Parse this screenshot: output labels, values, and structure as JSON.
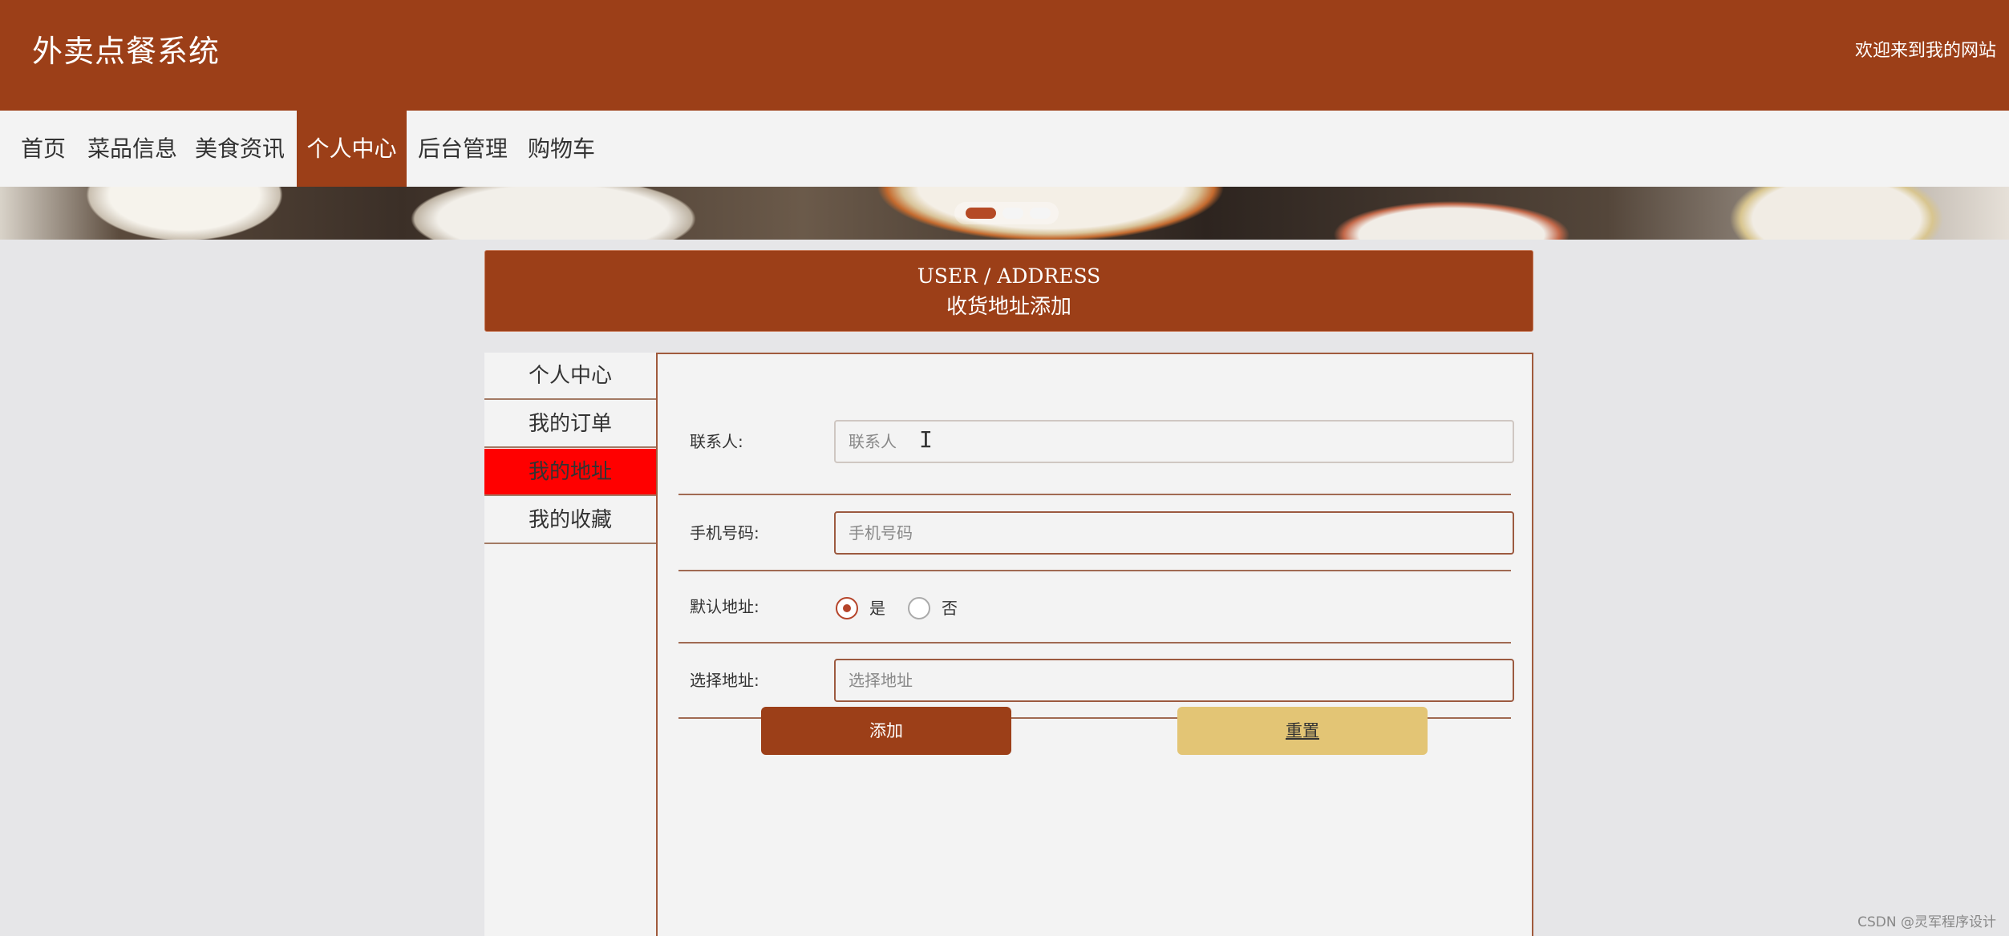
{
  "header": {
    "site_title": "外卖点餐系统",
    "welcome": "欢迎来到我的网站"
  },
  "nav": {
    "items": [
      {
        "label": "首页"
      },
      {
        "label": "菜品信息"
      },
      {
        "label": "美食资讯"
      },
      {
        "label": "个人中心",
        "active": true
      },
      {
        "label": "后台管理"
      },
      {
        "label": "购物车"
      }
    ]
  },
  "banner": {
    "slide_count": 3,
    "active_slide": 1
  },
  "page_title": {
    "en": "USER / ADDRESS",
    "cn": "收货地址添加"
  },
  "side_menu": {
    "items": [
      {
        "label": "个人中心"
      },
      {
        "label": "我的订单"
      },
      {
        "label": "我的地址",
        "active": true
      },
      {
        "label": "我的收藏"
      }
    ]
  },
  "form": {
    "contact": {
      "label": "联系人:",
      "placeholder": "联系人",
      "value": ""
    },
    "phone": {
      "label": "手机号码:",
      "placeholder": "手机号码",
      "value": ""
    },
    "default_address": {
      "label": "默认地址:",
      "options": [
        {
          "label": "是",
          "checked": true
        },
        {
          "label": "否",
          "checked": false
        }
      ]
    },
    "address": {
      "label": "选择地址:",
      "placeholder": "选择地址",
      "value": ""
    },
    "add_label": "添加",
    "reset_label": "重置"
  },
  "colors": {
    "brand": "#9c3f18",
    "active_menu": "#ff0000",
    "reset_button": "#e3c575"
  },
  "watermark": "CSDN @灵军程序设计"
}
